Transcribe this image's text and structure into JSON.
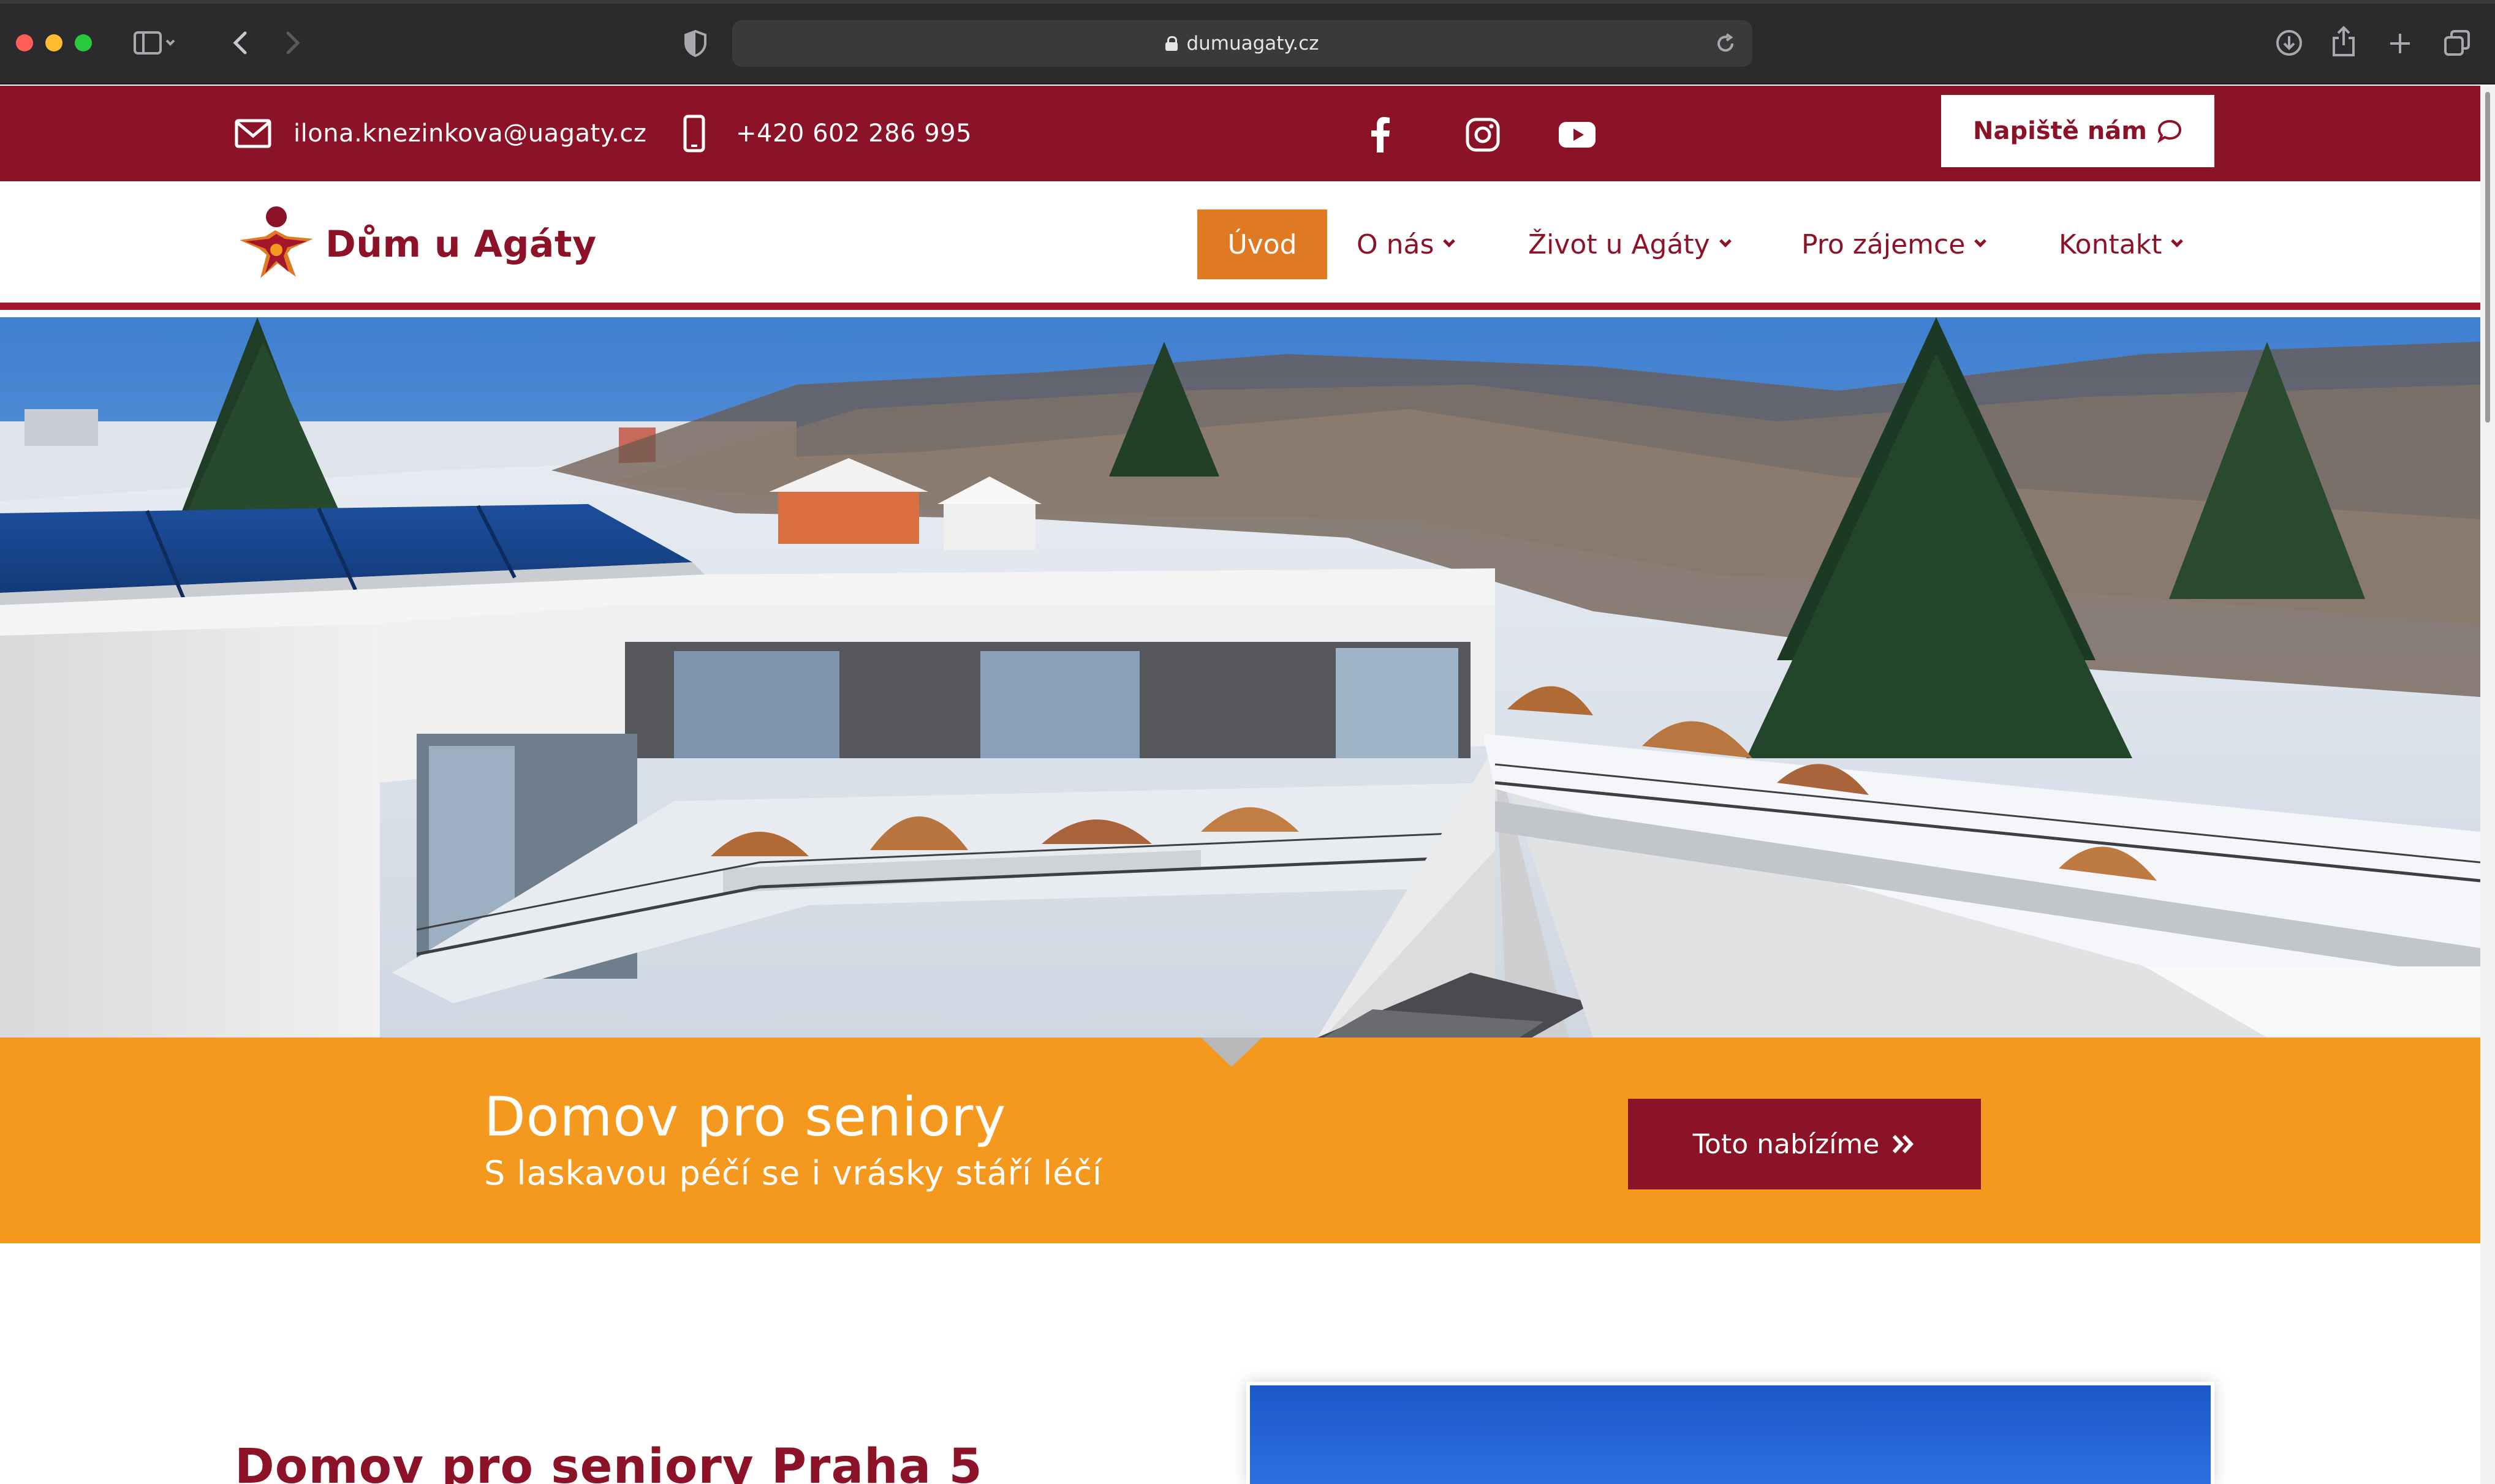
{
  "browser": {
    "url": "dumuagaty.cz"
  },
  "topbar": {
    "email": "ilona.knezinkova@uagaty.cz",
    "phone": "+420 602 286 995",
    "write_button": "Napiště nám"
  },
  "nav": {
    "logo_text": "Dům u Agáty",
    "items": [
      {
        "label": "Úvod"
      },
      {
        "label": "O nás"
      },
      {
        "label": "Život u Agáty"
      },
      {
        "label": "Pro zájemce"
      },
      {
        "label": "Kontakt"
      }
    ]
  },
  "banner": {
    "title": "Domov pro seniory",
    "subtitle": "S laskavou péčí se i vrásky stáří léčí",
    "button": "Toto nabízíme"
  },
  "content": {
    "heading": "Domov pro seniory Praha 5"
  },
  "colors": {
    "brand_red": "#8c1227",
    "accent_orange": "#f4991e",
    "nav_active": "#e07a22"
  },
  "icons": [
    "sidebar-icon",
    "back-icon",
    "forward-icon",
    "shield-icon",
    "reload-icon",
    "download-icon",
    "share-icon",
    "plus-icon",
    "tabs-icon",
    "mail-icon",
    "phone-icon",
    "facebook-icon",
    "instagram-icon",
    "youtube-icon",
    "chat-icon",
    "double-chevron-icon"
  ]
}
